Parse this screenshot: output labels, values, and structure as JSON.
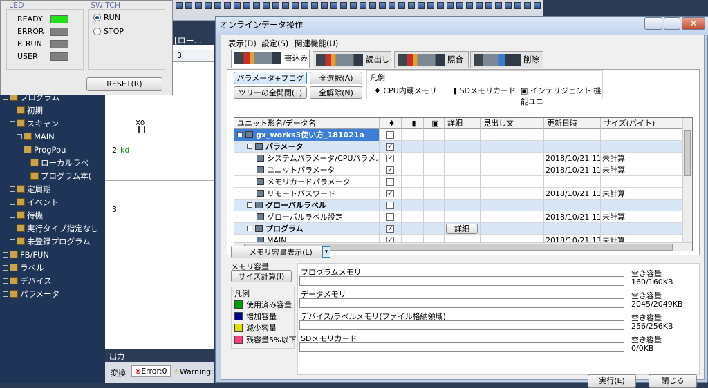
{
  "led_panel": {
    "led_title": "LED",
    "switch_title": "SWITCH",
    "leds": [
      {
        "label": "READY",
        "color": "#22e01a"
      },
      {
        "label": "ERROR",
        "color": "#808080"
      },
      {
        "label": "P. RUN",
        "color": "#808080"
      },
      {
        "label": "USER",
        "color": "#808080"
      }
    ],
    "switch_options": [
      {
        "label": "RUN",
        "selected": true
      },
      {
        "label": "STOP",
        "selected": false
      }
    ],
    "reset_label": "RESET(R)"
  },
  "editor": {
    "tab_title": "[ロー...",
    "col_header": "3",
    "rows": [
      {
        "num": "2",
        "text": "kd"
      },
      {
        "num": "3",
        "text": ""
      }
    ],
    "contact_label": "X0"
  },
  "sidebar": {
    "items": [
      {
        "label": "プログラム",
        "level": 0
      },
      {
        "label": "初期",
        "level": 1
      },
      {
        "label": "スキャン",
        "level": 1
      },
      {
        "label": "MAIN",
        "level": 2
      },
      {
        "label": "ProgPou",
        "level": 3
      },
      {
        "label": "ローカルラベ",
        "level": 4
      },
      {
        "label": "プログラム本(",
        "level": 4
      },
      {
        "label": "定周期",
        "level": 1
      },
      {
        "label": "イベント",
        "level": 1
      },
      {
        "label": "待機",
        "level": 1
      },
      {
        "label": "実行タイプ指定なし",
        "level": 1
      },
      {
        "label": "未登録プログラム",
        "level": 1
      },
      {
        "label": "FB/FUN",
        "level": 0
      },
      {
        "label": "ラベル",
        "level": 0
      },
      {
        "label": "デバイス",
        "level": 0
      },
      {
        "label": "パラメータ",
        "level": 0
      }
    ]
  },
  "output": {
    "title": "出力",
    "convert_label": "変換",
    "error_label": "Error:0",
    "warning_label": "Warning:"
  },
  "dialog": {
    "title": "オンラインデータ操作",
    "menu": [
      "表示(D)",
      "設定(S)",
      "関連機能(U)"
    ],
    "tabs": [
      {
        "label": "書込み",
        "active": true
      },
      {
        "label": "読出し",
        "active": false
      },
      {
        "label": "照合",
        "active": false
      },
      {
        "label": "削除",
        "active": false
      }
    ],
    "buttons": {
      "param_prog": "パラメータ+プログラム(F",
      "select_all": "全選択(A)",
      "tree_expand": "ツリーの全開閉(T)",
      "deselect_all": "全解除(N)"
    },
    "legend_top": {
      "title": "凡例",
      "items": [
        "CPU内蔵メモリ",
        "SDメモリカード",
        "インテリジェント 機能ユニ"
      ]
    },
    "grid": {
      "headers": [
        "ユニット形名/データ名",
        "",
        "",
        "",
        "詳細",
        "見出し文",
        "更新日時",
        "サイズ(バイト)"
      ],
      "rows": [
        {
          "name": "gx_works3使い方_181021a",
          "level": 0,
          "type": "root",
          "cb": false,
          "detail": "",
          "date": "",
          "size": ""
        },
        {
          "name": "パラメータ",
          "level": 1,
          "type": "group",
          "cb": true,
          "detail": "",
          "date": "",
          "size": ""
        },
        {
          "name": "システムパラメータ/CPUパラメ...",
          "level": 2,
          "type": "item",
          "cb": true,
          "detail": "",
          "date": "2018/10/21 11...",
          "size": "未計算"
        },
        {
          "name": "ユニットパラメータ",
          "level": 2,
          "type": "item",
          "cb": true,
          "detail": "",
          "date": "2018/10/21 11...",
          "size": "未計算"
        },
        {
          "name": "メモリカードパラメータ",
          "level": 2,
          "type": "item",
          "cb": false,
          "detail": "",
          "date": "",
          "size": ""
        },
        {
          "name": "リモートパスワード",
          "level": 2,
          "type": "item",
          "cb": true,
          "detail": "",
          "date": "2018/10/21 11...",
          "size": "未計算"
        },
        {
          "name": "グローバルラベル",
          "level": 1,
          "type": "group",
          "cb": false,
          "detail": "",
          "date": "",
          "size": ""
        },
        {
          "name": "グローバルラベル設定",
          "level": 2,
          "type": "item",
          "cb": false,
          "detail": "",
          "date": "2018/10/21 11...",
          "size": "未計算"
        },
        {
          "name": "プログラム",
          "level": 1,
          "type": "group",
          "cb": true,
          "detail": "詳細",
          "date": "",
          "size": ""
        },
        {
          "name": "MAIN",
          "level": 2,
          "type": "item",
          "cb": true,
          "detail": "",
          "date": "2018/10/21 13...",
          "size": "未計算"
        }
      ]
    },
    "memory_display_btn": "メモリ容量表示(L)",
    "memory": {
      "title": "メモリ容量",
      "size_calc_btn": "サイズ計算(I)",
      "legend_title": "凡例",
      "legend": [
        {
          "label": "使用済み容量",
          "color": "#00a000"
        },
        {
          "label": "増加容量",
          "color": "#00008b"
        },
        {
          "label": "減少容量",
          "color": "#e0e000"
        },
        {
          "label": "残容量5%以下",
          "color": "#ff3d7f"
        }
      ],
      "free_label": "空き容量",
      "bars": [
        {
          "name": "プログラムメモリ",
          "free": "160/160KB"
        },
        {
          "name": "データメモリ",
          "free": "2045/2049KB"
        },
        {
          "name": "デバイス/ラベルメモリ(ファイル格納領域)",
          "free": "256/256KB"
        },
        {
          "name": "SDメモリカード",
          "free": "0/0KB"
        }
      ]
    },
    "execute_btn": "実行(E)",
    "close_btn": "閉じる"
  }
}
